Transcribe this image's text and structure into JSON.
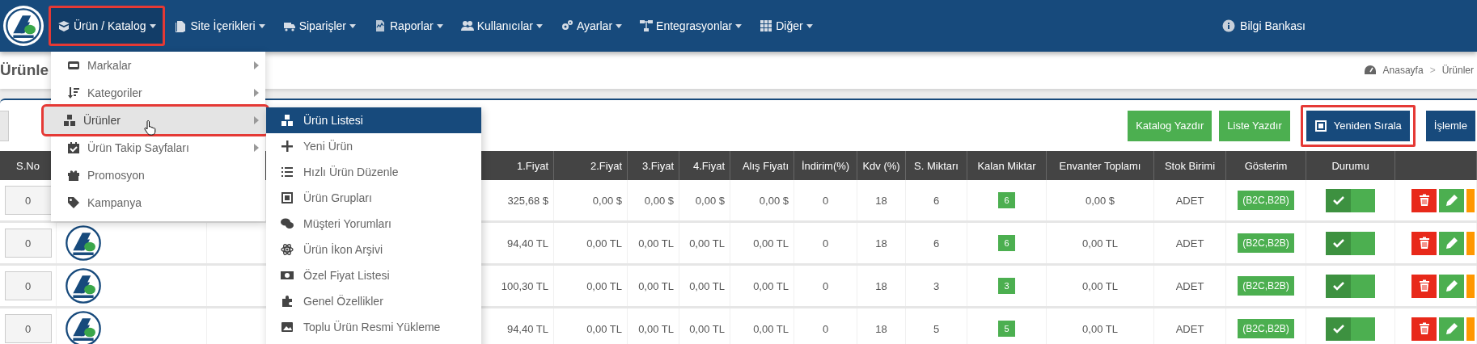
{
  "navbar": {
    "items": [
      {
        "label": "Ürün / Katalog",
        "highlighted": true
      },
      {
        "label": "Site İçerikleri",
        "highlighted": false
      },
      {
        "label": "Siparişler",
        "highlighted": false
      },
      {
        "label": "Raporlar",
        "highlighted": false
      },
      {
        "label": "Kullanıcılar",
        "highlighted": false
      },
      {
        "label": "Ayarlar",
        "highlighted": false
      },
      {
        "label": "Entegrasyonlar",
        "highlighted": false
      },
      {
        "label": "Diğer",
        "highlighted": false
      }
    ],
    "help_link": "Bilgi Bankası"
  },
  "page": {
    "title": "Ürünle",
    "breadcrumb": [
      "Anasayfa",
      "Ürünler"
    ],
    "breadcrumb_separator": ">"
  },
  "toolbar": {
    "buttons": [
      {
        "label": "Katalog Yazdır",
        "kind": "green",
        "highlighted": false
      },
      {
        "label": "Liste Yazdır",
        "kind": "green",
        "highlighted": false
      },
      {
        "label": "Yeniden Sırala",
        "kind": "primary",
        "highlighted": true
      },
      {
        "label": "İşlemle",
        "kind": "primary",
        "highlighted": false
      }
    ]
  },
  "table": {
    "columns": [
      "S.No",
      "1.Fiyat",
      "2.Fiyat",
      "3.Fiyat",
      "4.Fiyat",
      "Alış Fiyatı",
      "İndirim(%)",
      "Kdv (%)",
      "S. Miktarı",
      "Kalan Miktar",
      "Envanter Toplamı",
      "Stok Birimi",
      "Gösterim",
      "Durumu"
    ],
    "rows": [
      {
        "sno": "0",
        "prices": [
          "325,68 $",
          "0,00 $",
          "0,00 $",
          "0,00 $",
          "0,00 $"
        ],
        "discount": "0",
        "vat": "18",
        "sold": "6",
        "remaining": "6",
        "inventory_total": "0,00 $",
        "unit": "ADET",
        "display": "(B2C,B2B)",
        "active": true
      },
      {
        "sno": "0",
        "prices": [
          "94,40 TL",
          "0,00 TL",
          "0,00 TL",
          "0,00 TL",
          "0,00 TL"
        ],
        "discount": "0",
        "vat": "18",
        "sold": "6",
        "remaining": "6",
        "inventory_total": "0,00 TL",
        "unit": "ADET",
        "display": "(B2C,B2B)",
        "active": true
      },
      {
        "sno": "0",
        "prices": [
          "100,30 TL",
          "0,00 TL",
          "0,00 TL",
          "0,00 TL",
          "0,00 TL"
        ],
        "discount": "0",
        "vat": "18",
        "sold": "3",
        "remaining": "3",
        "inventory_total": "0,00 TL",
        "unit": "ADET",
        "display": "(B2C,B2B)",
        "active": true
      },
      {
        "sno": "0",
        "prices": [
          "94,40 TL",
          "0,00 TL",
          "0,00 TL",
          "0,00 TL",
          "0,00 TL"
        ],
        "discount": "0",
        "vat": "18",
        "sold": "5",
        "remaining": "5",
        "inventory_total": "0,00 TL",
        "unit": "ADET",
        "display": "(B2C,B2B)",
        "active": true
      }
    ]
  },
  "catalog_menu": {
    "items": [
      {
        "label": "Markalar",
        "has_submenu": true,
        "selected": false,
        "highlighted": false
      },
      {
        "label": "Kategoriler",
        "has_submenu": true,
        "selected": false,
        "highlighted": false
      },
      {
        "label": "Ürünler",
        "has_submenu": true,
        "selected": true,
        "highlighted": true
      },
      {
        "label": "Ürün Takip Sayfaları",
        "has_submenu": true,
        "selected": false,
        "highlighted": false
      },
      {
        "label": "Promosyon",
        "has_submenu": false,
        "selected": false,
        "highlighted": false
      },
      {
        "label": "Kampanya",
        "has_submenu": false,
        "selected": false,
        "highlighted": false
      }
    ],
    "submenu": {
      "items": [
        {
          "label": "Ürün Listesi",
          "selected": true
        },
        {
          "label": "Yeni Ürün",
          "selected": false
        },
        {
          "label": "Hızlı Ürün Düzenle",
          "selected": false
        },
        {
          "label": "Ürün Grupları",
          "selected": false
        },
        {
          "label": "Müşteri Yorumları",
          "selected": false
        },
        {
          "label": "Ürün İkon Arşivi",
          "selected": false
        },
        {
          "label": "Özel Fiyat Listesi",
          "selected": false
        },
        {
          "label": "Genel Özellikler",
          "selected": false
        },
        {
          "label": "Toplu Ürün Resmi Yükleme",
          "selected": false
        }
      ]
    }
  }
}
